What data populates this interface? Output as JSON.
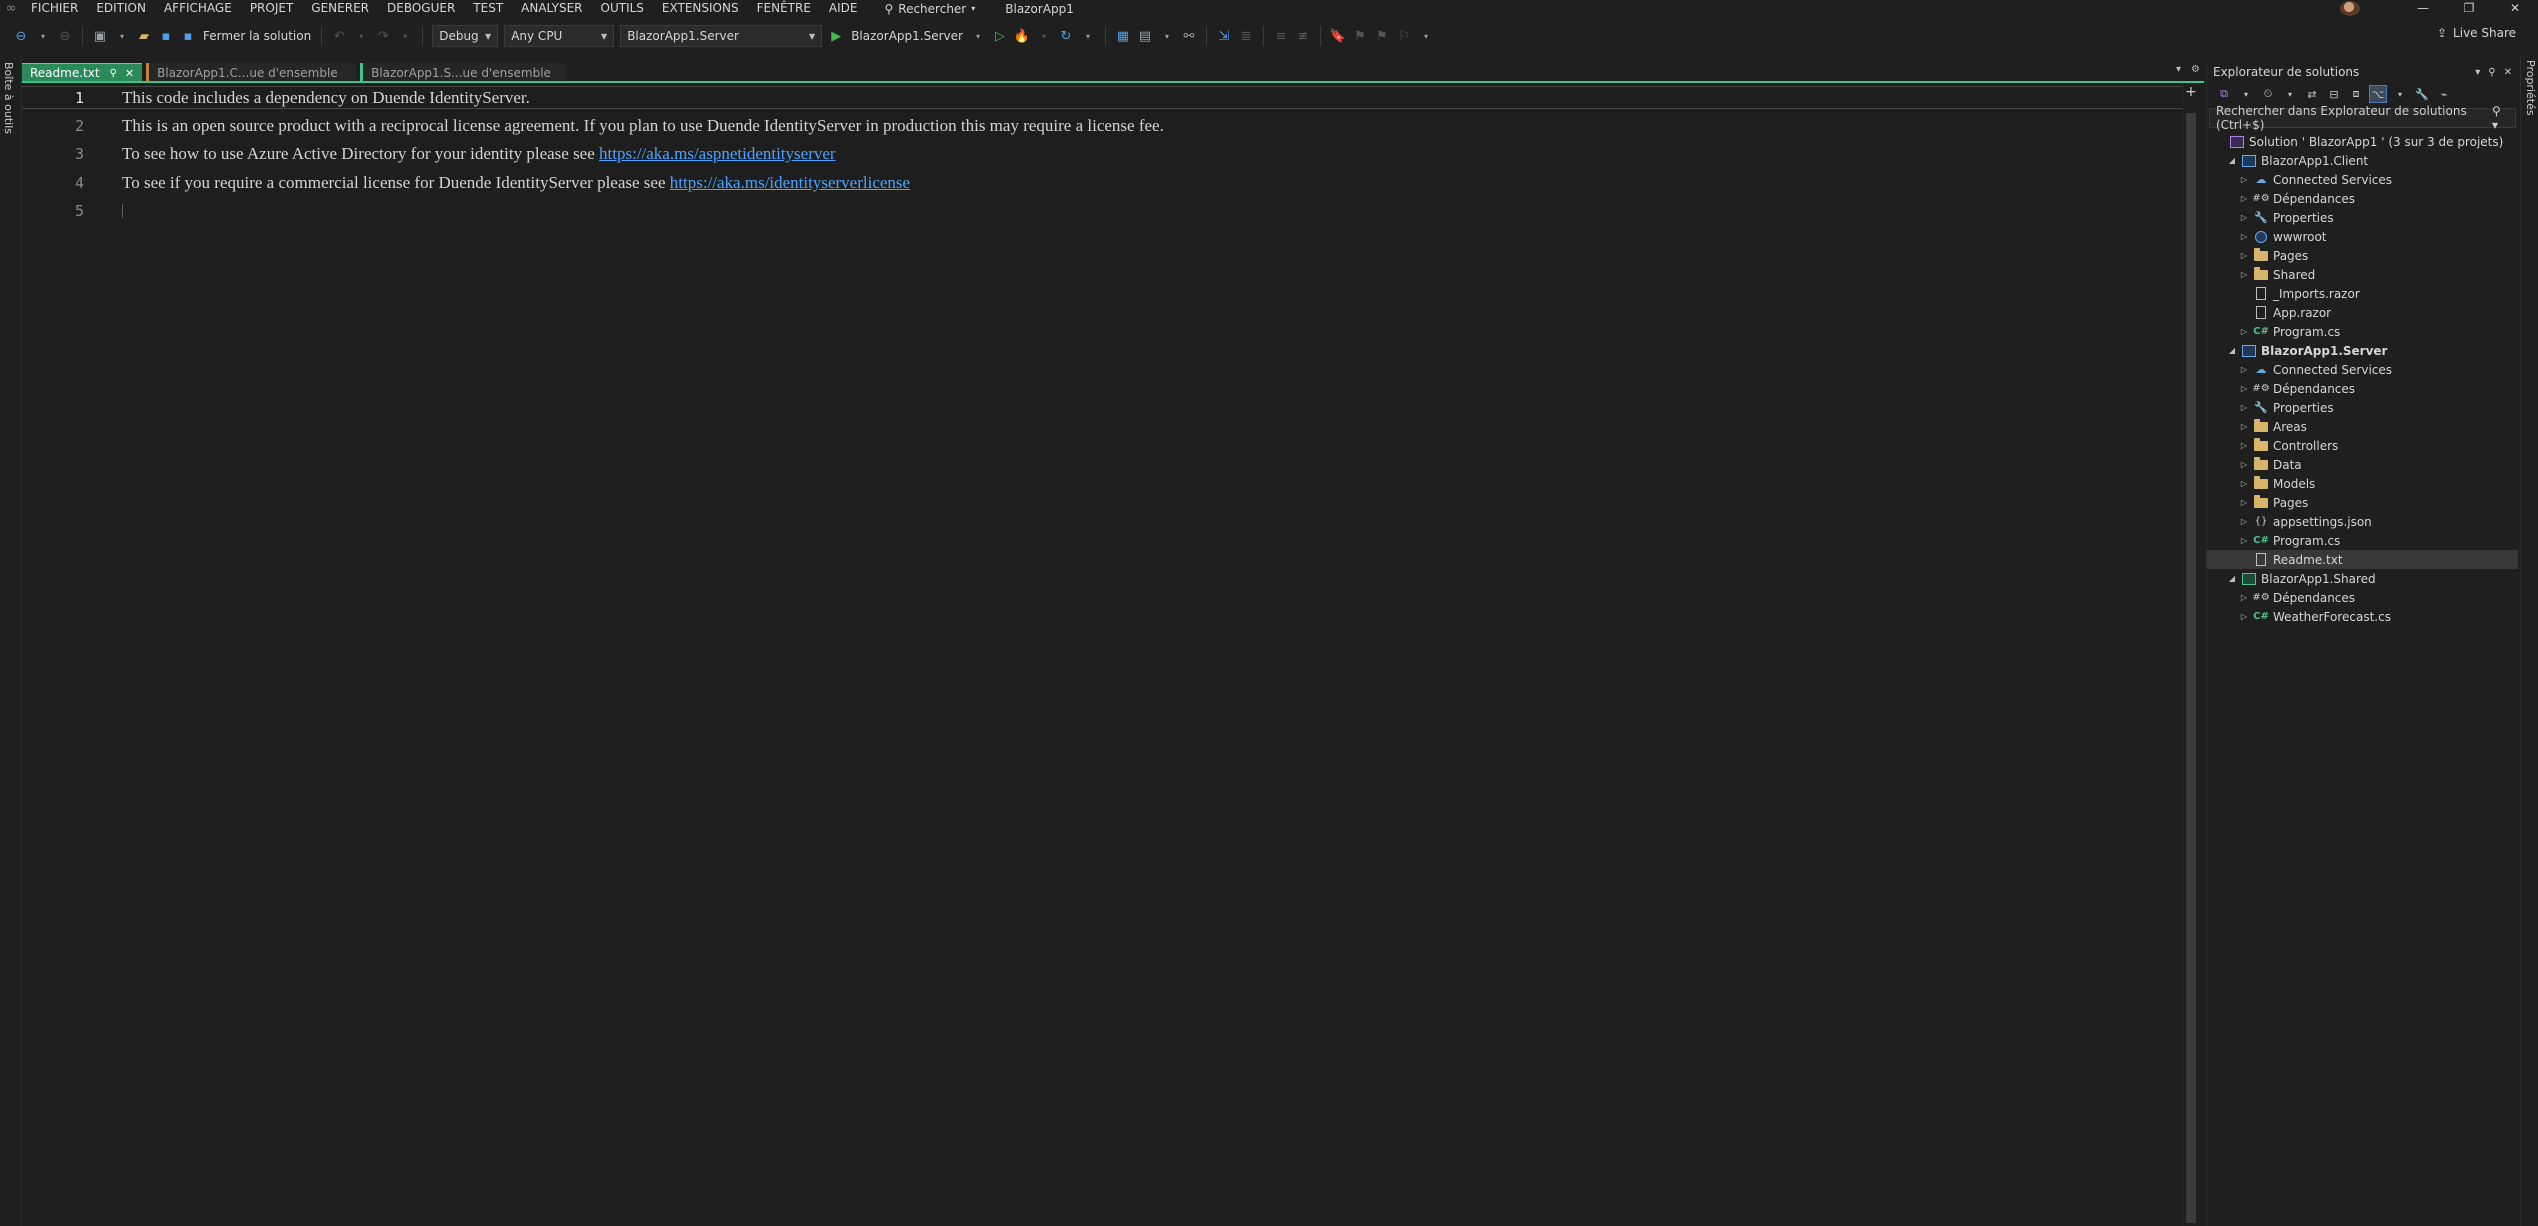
{
  "menu": {
    "items": [
      "FICHIER",
      "EDITION",
      "AFFICHAGE",
      "PROJET",
      "GENERER",
      "DEBOGUER",
      "TEST",
      "ANALYSER",
      "OUTILS",
      "EXTENSIONS",
      "FENÊTRE",
      "AIDE"
    ],
    "search_label": "Rechercher",
    "window_title": "BlazorApp1"
  },
  "toolbar": {
    "close_solution_label": "Fermer la solution",
    "configuration": "Debug",
    "platform": "Any CPU",
    "startup_project": "BlazorApp1.Server",
    "run_label": "BlazorApp1.Server",
    "live_share_label": "Live Share"
  },
  "left_strip": {
    "label": "Boîte à outils"
  },
  "right_strip": {
    "label": "Propriétés"
  },
  "tabs": [
    {
      "label": "Readme.txt",
      "active": true
    },
    {
      "label": "BlazorApp1.C...ue d'ensemble",
      "active": false
    },
    {
      "label": "BlazorApp1.S...ue d'ensemble",
      "active": false
    }
  ],
  "editor": {
    "lines": [
      {
        "number": "1",
        "text": "This code includes a dependency on Duende IdentityServer.",
        "link": ""
      },
      {
        "number": "2",
        "text": "This is an open source product with a reciprocal license agreement. If you plan to use Duende IdentityServer in production this may require a license fee.",
        "link": ""
      },
      {
        "number": "3",
        "text": "To see how to use Azure Active Directory for your identity please see ",
        "link": "https://aka.ms/aspnetidentityserver"
      },
      {
        "number": "4",
        "text": "To see if you require a commercial license for Duende IdentityServer please see ",
        "link": "https://aka.ms/identityserverlicense"
      },
      {
        "number": "5",
        "text": "",
        "link": ""
      }
    ]
  },
  "solution_explorer": {
    "title": "Explorateur de solutions",
    "search_placeholder": "Rechercher dans Explorateur de solutions (Ctrl+$)",
    "nodes": [
      {
        "label": "Solution ' BlazorApp1 ' (3 sur 3 de projets)",
        "icon": "solution-icon",
        "level": 0,
        "expander": "none",
        "bold": false,
        "selected": false
      },
      {
        "label": "BlazorApp1.Client",
        "icon": "project-icon",
        "level": 1,
        "expander": "expanded",
        "bold": false,
        "selected": false
      },
      {
        "label": "Connected Services",
        "icon": "connected-services-icon",
        "level": 2,
        "expander": "collapsed",
        "bold": false,
        "selected": false
      },
      {
        "label": "Dépendances",
        "icon": "dependencies-icon",
        "level": 2,
        "expander": "collapsed",
        "bold": false,
        "selected": false
      },
      {
        "label": "Properties",
        "icon": "properties-icon",
        "level": 2,
        "expander": "collapsed",
        "bold": false,
        "selected": false
      },
      {
        "label": "wwwroot",
        "icon": "globe-icon",
        "level": 2,
        "expander": "collapsed",
        "bold": false,
        "selected": false
      },
      {
        "label": "Pages",
        "icon": "folder-icon",
        "level": 2,
        "expander": "collapsed",
        "bold": false,
        "selected": false
      },
      {
        "label": "Shared",
        "icon": "folder-icon",
        "level": 2,
        "expander": "collapsed",
        "bold": false,
        "selected": false
      },
      {
        "label": "_Imports.razor",
        "icon": "file-icon",
        "level": 2,
        "expander": "none",
        "bold": false,
        "selected": false
      },
      {
        "label": "App.razor",
        "icon": "file-icon",
        "level": 2,
        "expander": "none",
        "bold": false,
        "selected": false
      },
      {
        "label": "Program.cs",
        "icon": "csharp-file-icon",
        "level": 2,
        "expander": "collapsed",
        "bold": false,
        "selected": false
      },
      {
        "label": "BlazorApp1.Server",
        "icon": "project-icon",
        "level": 1,
        "expander": "expanded",
        "bold": true,
        "selected": false
      },
      {
        "label": "Connected Services",
        "icon": "connected-services-icon",
        "level": 2,
        "expander": "collapsed",
        "bold": false,
        "selected": false
      },
      {
        "label": "Dépendances",
        "icon": "dependencies-icon",
        "level": 2,
        "expander": "collapsed",
        "bold": false,
        "selected": false
      },
      {
        "label": "Properties",
        "icon": "properties-icon",
        "level": 2,
        "expander": "collapsed",
        "bold": false,
        "selected": false
      },
      {
        "label": "Areas",
        "icon": "folder-icon",
        "level": 2,
        "expander": "collapsed",
        "bold": false,
        "selected": false
      },
      {
        "label": "Controllers",
        "icon": "folder-icon",
        "level": 2,
        "expander": "collapsed",
        "bold": false,
        "selected": false
      },
      {
        "label": "Data",
        "icon": "folder-icon",
        "level": 2,
        "expander": "collapsed",
        "bold": false,
        "selected": false
      },
      {
        "label": "Models",
        "icon": "folder-icon",
        "level": 2,
        "expander": "collapsed",
        "bold": false,
        "selected": false
      },
      {
        "label": "Pages",
        "icon": "folder-icon",
        "level": 2,
        "expander": "collapsed",
        "bold": false,
        "selected": false
      },
      {
        "label": "appsettings.json",
        "icon": "json-file-icon",
        "level": 2,
        "expander": "collapsed",
        "bold": false,
        "selected": false
      },
      {
        "label": "Program.cs",
        "icon": "csharp-file-icon",
        "level": 2,
        "expander": "collapsed",
        "bold": false,
        "selected": false
      },
      {
        "label": "Readme.txt",
        "icon": "file-icon",
        "level": 2,
        "expander": "none",
        "bold": false,
        "selected": true
      },
      {
        "label": "BlazorApp1.Shared",
        "icon": "shared-project-icon",
        "level": 1,
        "expander": "expanded",
        "bold": false,
        "selected": false
      },
      {
        "label": "Dépendances",
        "icon": "dependencies-icon",
        "level": 2,
        "expander": "collapsed",
        "bold": false,
        "selected": false
      },
      {
        "label": "WeatherForecast.cs",
        "icon": "csharp-file-icon",
        "level": 2,
        "expander": "collapsed",
        "bold": false,
        "selected": false
      }
    ]
  }
}
